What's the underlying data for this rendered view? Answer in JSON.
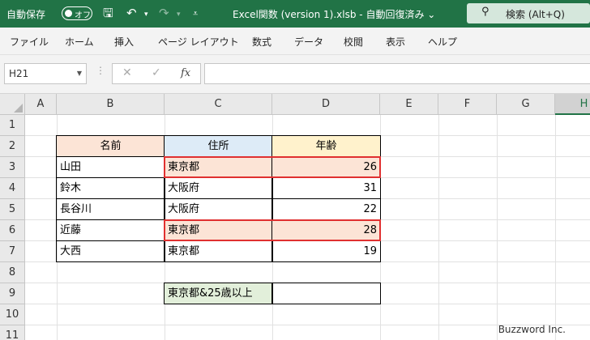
{
  "titlebar": {
    "autosave_label": "自動保存",
    "autosave_state": "オフ",
    "filename": "Excel関数 (version 1).xlsb  -  自動回復済み  ⌄",
    "search_placeholder": "検索 (Alt+Q)",
    "bg_color": "#217346"
  },
  "ribbon": {
    "tabs": [
      "ファイル",
      "ホーム",
      "挿入",
      "ページ レイアウト",
      "数式",
      "データ",
      "校閲",
      "表示",
      "ヘルプ"
    ]
  },
  "formula_bar": {
    "name_box": "H21",
    "cancel": "✕",
    "enter": "✓",
    "fx": "fx",
    "formula": ""
  },
  "sheet": {
    "columns": [
      "A",
      "B",
      "C",
      "D",
      "E",
      "F",
      "G",
      "H"
    ],
    "active_column": "H",
    "rows": [
      "1",
      "2",
      "3",
      "4",
      "5",
      "6",
      "7",
      "8",
      "9",
      "10",
      "11"
    ],
    "table": {
      "headers": [
        "名前",
        "住所",
        "年齢"
      ],
      "records": [
        {
          "name": "山田",
          "address": "東京都",
          "age": "26",
          "highlight": true
        },
        {
          "name": "鈴木",
          "address": "大阪府",
          "age": "31",
          "highlight": false
        },
        {
          "name": "長谷川",
          "address": "大阪府",
          "age": "22",
          "highlight": false
        },
        {
          "name": "近藤",
          "address": "東京都",
          "age": "28",
          "highlight": true
        },
        {
          "name": "大西",
          "address": "東京都",
          "age": "19",
          "highlight": false
        }
      ]
    },
    "criteria_label": "東京都&25歳以上",
    "criteria_value": ""
  },
  "watermark": "Buzzword Inc.",
  "colors": {
    "header_name": "#fce4d6",
    "header_address": "#ddebf7",
    "header_age": "#fff2cc",
    "highlight": "#fce4d6",
    "highlight_border": "#e03030",
    "criteria": "#e2efda"
  }
}
